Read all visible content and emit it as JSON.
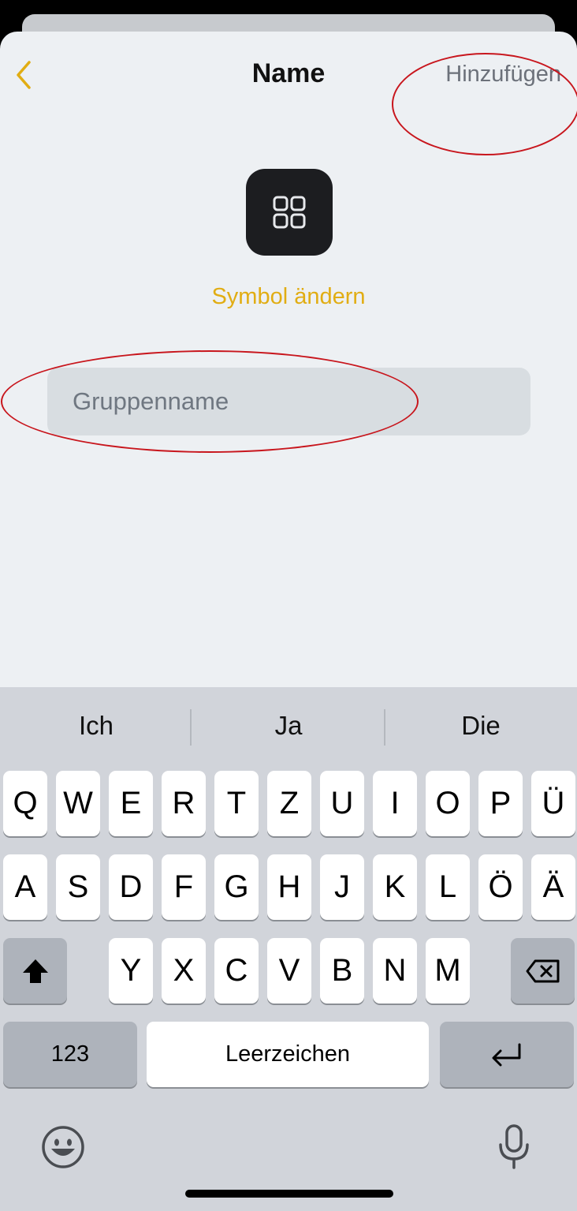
{
  "header": {
    "title": "Name",
    "add_label": "Hinzufügen"
  },
  "main": {
    "change_symbol_label": "Symbol ändern",
    "group_name_placeholder": "Gruppenname",
    "group_name_value": ""
  },
  "keyboard": {
    "suggestions": [
      "Ich",
      "Ja",
      "Die"
    ],
    "row1": [
      "Q",
      "W",
      "E",
      "R",
      "T",
      "Z",
      "U",
      "I",
      "O",
      "P",
      "Ü"
    ],
    "row2": [
      "A",
      "S",
      "D",
      "F",
      "G",
      "H",
      "J",
      "K",
      "L",
      "Ö",
      "Ä"
    ],
    "row3": [
      "Y",
      "X",
      "C",
      "V",
      "B",
      "N",
      "M"
    ],
    "numbers_label": "123",
    "space_label": "Leerzeichen"
  },
  "colors": {
    "accent": "#e1ad13",
    "annotation": "#c8161d",
    "icon_tile": "#1c1d20"
  },
  "icons": [
    "chevron-left-icon",
    "grid-icon",
    "shift-icon",
    "backspace-icon",
    "return-icon",
    "emoji-icon",
    "microphone-icon"
  ]
}
